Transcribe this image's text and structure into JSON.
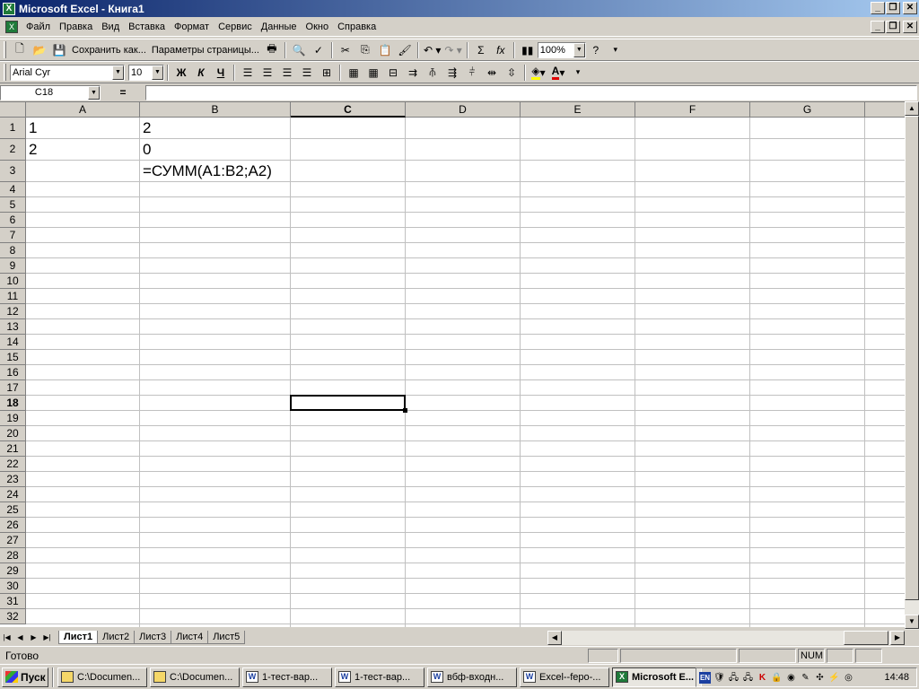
{
  "window": {
    "title": "Microsoft Excel - Книга1",
    "app_icon": "X"
  },
  "menu": {
    "items": [
      "Файл",
      "Правка",
      "Вид",
      "Вставка",
      "Формат",
      "Сервис",
      "Данные",
      "Окно",
      "Справка"
    ]
  },
  "toolbar_standard": {
    "save_as_label": "Сохранить как...",
    "page_setup_label": "Параметры страницы...",
    "sum_label": "Σ",
    "fx_label": "fx",
    "zoom": "100%",
    "help_label": "?"
  },
  "toolbar_format": {
    "font": "Arial Cyr",
    "size": "10",
    "bold": "Ж",
    "italic": "К",
    "underline": "Ч"
  },
  "formula_bar": {
    "name_box": "C18",
    "equals": "=",
    "value": ""
  },
  "grid": {
    "columns": [
      "A",
      "B",
      "C",
      "D",
      "E",
      "F",
      "G"
    ],
    "rows": [
      "1",
      "2",
      "3",
      "4",
      "5",
      "6",
      "7",
      "8",
      "9",
      "10",
      "11",
      "12",
      "13",
      "14",
      "15",
      "16",
      "17",
      "18",
      "19",
      "20",
      "21",
      "22",
      "23",
      "24",
      "25",
      "26",
      "27",
      "28",
      "29",
      "30",
      "31",
      "32"
    ],
    "selected_cell": "C18",
    "cells": {
      "A1": "1",
      "B1": "2",
      "A2": "2",
      "B2": "0",
      "B3": "=СУММ(A1:B2;A2)"
    }
  },
  "sheets": {
    "tabs": [
      "Лист1",
      "Лист2",
      "Лист3",
      "Лист4",
      "Лист5"
    ],
    "active": "Лист1"
  },
  "status": {
    "text": "Готово",
    "num": "NUM"
  },
  "taskbar": {
    "start": "Пуск",
    "buttons": [
      {
        "label": "C:\\Documen...",
        "icon": "folder"
      },
      {
        "label": "C:\\Documen...",
        "icon": "folder"
      },
      {
        "label": "1-тест-вар...",
        "icon": "word"
      },
      {
        "label": "1-тест-вар...",
        "icon": "word"
      },
      {
        "label": "вбф-входн...",
        "icon": "word"
      },
      {
        "label": "Excel--fepo-...",
        "icon": "word"
      },
      {
        "label": "Microsoft E...",
        "icon": "excel",
        "active": true
      }
    ],
    "lang": "EN",
    "clock": "14:48"
  }
}
